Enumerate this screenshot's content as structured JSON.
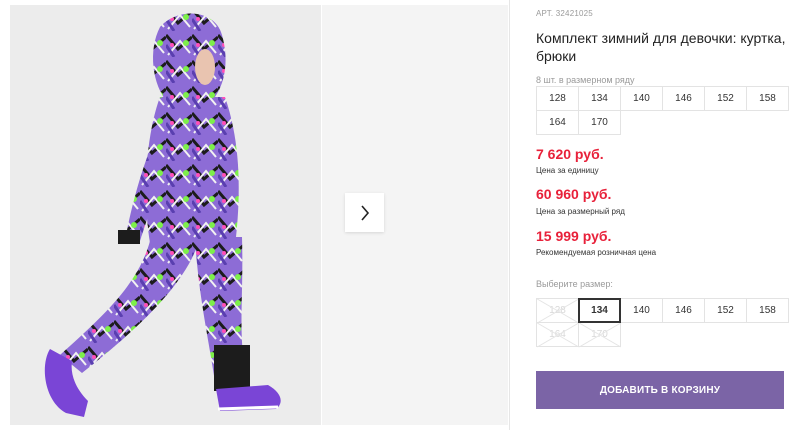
{
  "product": {
    "article": "АРТ. 32421025",
    "title": "Комплект зимний для девочки: куртка, брюки",
    "image_alt": "girl-in-purple-graffiti-snowsuit"
  },
  "size_row": {
    "caption": "8 шт. в размерном ряду",
    "sizes": [
      "128",
      "134",
      "140",
      "146",
      "152",
      "158",
      "164",
      "170"
    ]
  },
  "prices": {
    "unit_price": "7 620 руб.",
    "unit_caption": "Цена за единицу",
    "row_price": "60 960 руб.",
    "row_caption": "Цена за размерный ряд",
    "retail_price": "15 999 руб.",
    "retail_caption": "Рекомендуемая розничная цена"
  },
  "size_select": {
    "caption": "Выберите размер:",
    "options": [
      {
        "label": "128",
        "state": "disabled"
      },
      {
        "label": "134",
        "state": "selected"
      },
      {
        "label": "140",
        "state": "available"
      },
      {
        "label": "146",
        "state": "available"
      },
      {
        "label": "152",
        "state": "available"
      },
      {
        "label": "158",
        "state": "available"
      },
      {
        "label": "164",
        "state": "disabled"
      },
      {
        "label": "170",
        "state": "disabled"
      }
    ]
  },
  "cart": {
    "label": "ДОБАВИТЬ В КОРЗИНУ"
  },
  "gallery": {
    "next_icon": "chevron-right-icon"
  },
  "colors": {
    "accent": "#7b64a6",
    "price": "#e8213a"
  }
}
